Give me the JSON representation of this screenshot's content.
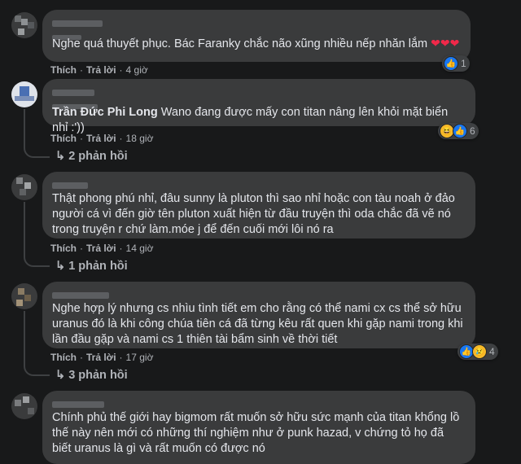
{
  "comments": [
    {
      "text": "Nghe quá thuyết phục. Bác Faranky chắc não xũng nhiều nếp nhăn lắm",
      "hearts": "❤❤❤",
      "like": "Thích",
      "reply": "Trả lời",
      "time": "4 giờ",
      "reactions": "1"
    },
    {
      "mention": "Trần Đức Phi Long",
      "text": " Wano đang được mấy con titan nâng lên khỏi mặt biển nhỉ :'))",
      "like": "Thích",
      "reply": "Trả lời",
      "time": "18 giờ",
      "reactions": "6",
      "replies": "2 phản hồi"
    },
    {
      "text": "Thật phong phú nhỉ, đâu sunny là pluton thì sao nhỉ hoặc con tàu noah ở đảo người cá vì đến giờ tên pluton xuất hiện từ đầu truyện thì oda chắc đã vẽ nó trong truyện r chứ làm.móe j để đến cuối mới lôi nó ra",
      "like": "Thích",
      "reply": "Trả lời",
      "time": "14 giờ",
      "replies": "1 phản hồi"
    },
    {
      "text": "Nghe hợp lý nhưng cs nhìu tình tiết em cho rằng có thể nami cx cs thể sở hữu uranus đó là khi công chúa tiên cá đã từng kêu rất quen khi gặp nami trong khi lần đầu gặp và nami cs 1 thiên tài bẩm sinh về thời tiết",
      "like": "Thích",
      "reply": "Trả lời",
      "time": "17 giờ",
      "reactions": "4",
      "replies": "3 phản hồi"
    },
    {
      "text": "Chính phủ thế giới hay bigmom rất muốn sở hữu sức mạnh của titan khổng lồ thế này nên mới có những thí nghiệm như ở punk hazad, v chứng tỏ họ đã biết uranus là gì và rất muốn có được nó"
    }
  ],
  "colors": {
    "background": "#18191a",
    "bubble": "#3a3b3c",
    "meta": "#b0b3b8",
    "text": "#e4e6eb"
  },
  "icons": [
    "like-icon",
    "haha-icon",
    "sad-icon",
    "heart-icon"
  ]
}
